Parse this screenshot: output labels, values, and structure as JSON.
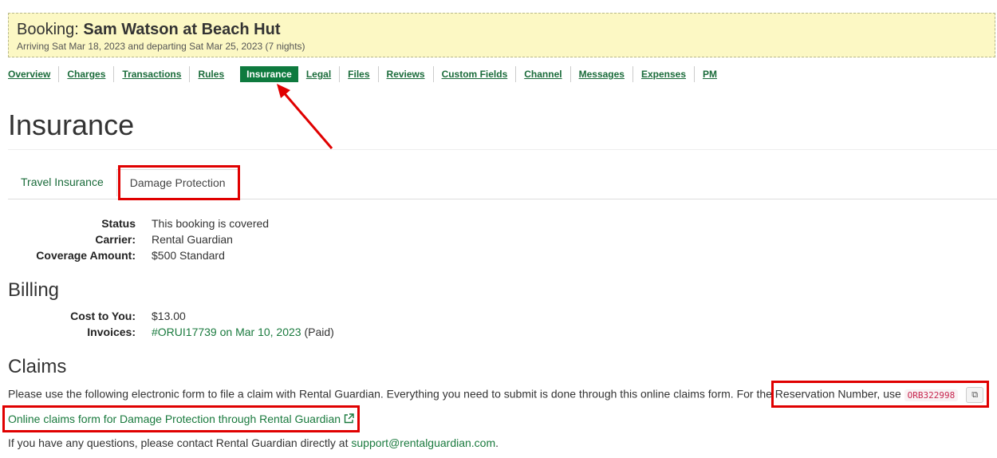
{
  "booking": {
    "prefix": "Booking:",
    "name": "Sam Watson at Beach Hut",
    "dates": "Arriving Sat Mar 18, 2023 and departing Sat Mar 25, 2023 (7 nights)"
  },
  "nav": {
    "items": [
      "Overview",
      "Charges",
      "Transactions",
      "Rules",
      "Insurance",
      "Legal",
      "Files",
      "Reviews",
      "Custom Fields",
      "Channel",
      "Messages",
      "Expenses",
      "PM"
    ],
    "active": "Insurance"
  },
  "page_title": "Insurance",
  "tabs": [
    "Travel Insurance",
    "Damage Protection"
  ],
  "coverage": {
    "status_label": "Status",
    "status_value": "This booking is covered",
    "carrier_label": "Carrier:",
    "carrier_value": "Rental Guardian",
    "amount_label": "Coverage Amount:",
    "amount_value": "$500 Standard"
  },
  "billing": {
    "heading": "Billing",
    "cost_label": "Cost to You:",
    "cost_value": "$13.00",
    "invoices_label": "Invoices:",
    "invoice_link": "#ORUI17739 on Mar 10, 2023",
    "invoice_status": "(Paid)"
  },
  "claims": {
    "heading": "Claims",
    "text": "Please use the following electronic form to file a claim with Rental Guardian. Everything you need to submit is done through this online claims form. For the Reservation Number, use",
    "reservation_number": "ORB322998",
    "form_link": "Online claims form for Damage Protection through Rental Guardian",
    "contact_text": "If you have any questions, please contact Rental Guardian directly at",
    "contact_email": "support@rentalguardian.com",
    "contact_end": "."
  },
  "icons": {
    "copy": "copy-icon",
    "external": "external-link-icon"
  },
  "colors": {
    "accent": "#0e7a3e",
    "banner_bg": "#fcf8c4",
    "annotation": "#e00000"
  }
}
